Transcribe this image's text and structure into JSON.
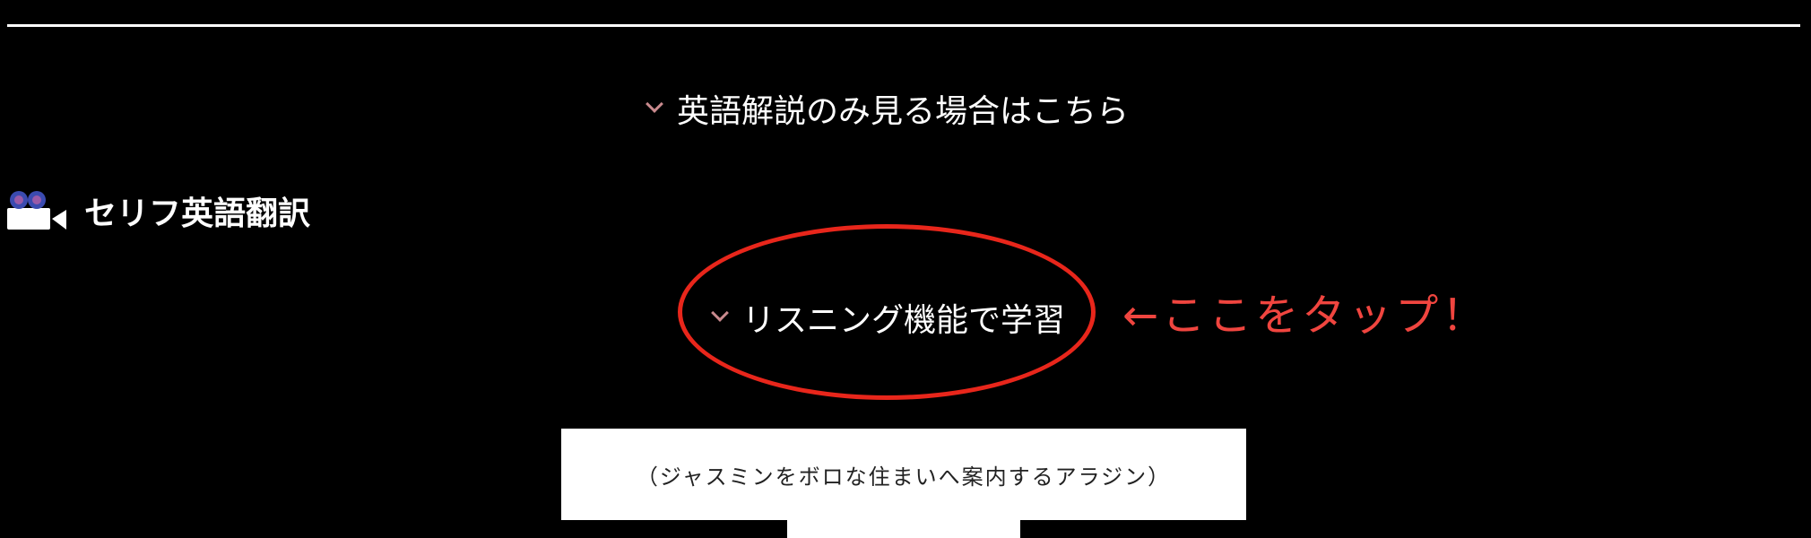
{
  "explanation_toggle": {
    "label": "英語解説のみ見る場合はこちら",
    "icon": "chevron-down-icon"
  },
  "section": {
    "title": "セリフ英語翻訳",
    "icon": "video-camera-icon"
  },
  "listening_toggle": {
    "label": "リスニング機能で学習",
    "icon": "chevron-down-icon"
  },
  "annotation": {
    "text": "←ここをタップ！",
    "color": "#f0453f",
    "oval_color": "#e8261b"
  },
  "caption": {
    "text": "（ジャスミンをボロな住まいへ案内するアラジン）"
  },
  "colors": {
    "background": "#000000",
    "chevron": "#c98a8e",
    "text": "#ffffff"
  }
}
